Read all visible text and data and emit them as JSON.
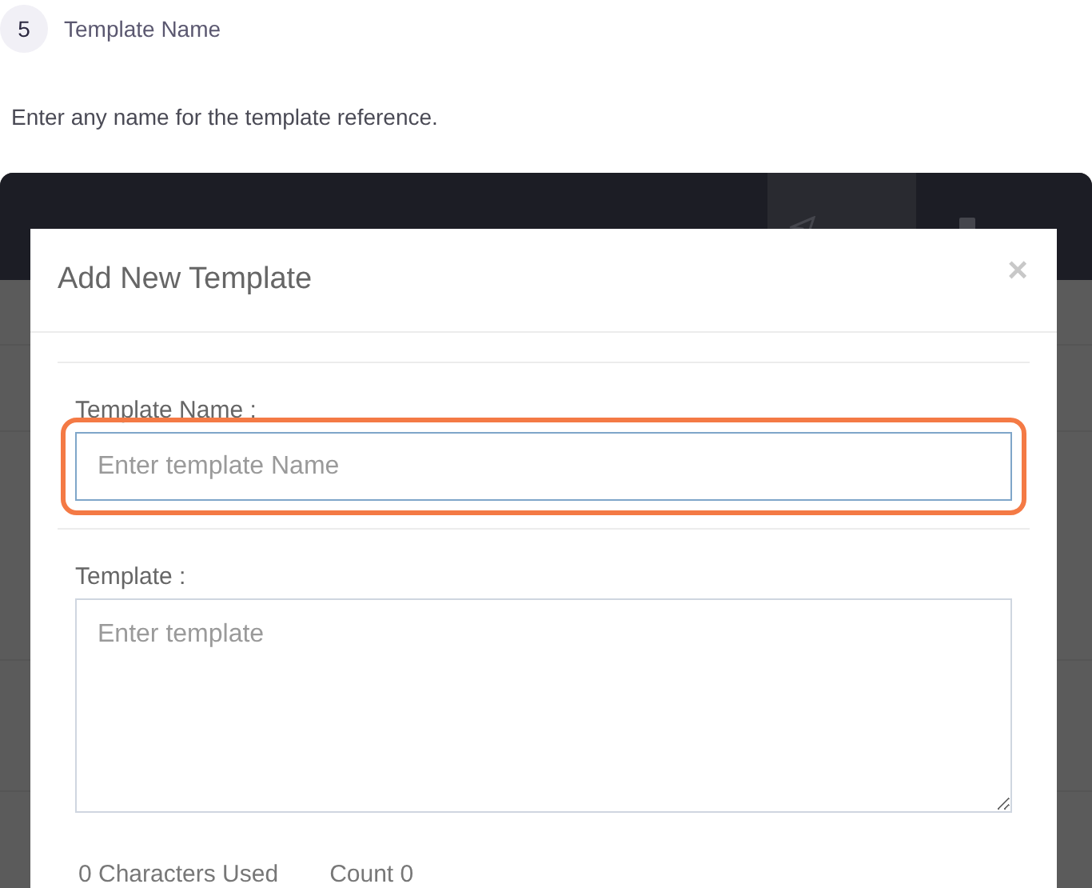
{
  "step": {
    "number": "5",
    "title": "Template Name"
  },
  "description": "Enter any name for the template reference.",
  "background": {
    "nav_tabs": [
      {
        "selected": true
      },
      {
        "selected": false
      }
    ]
  },
  "modal": {
    "title": "Add New Template",
    "close": "×",
    "fields": [
      {
        "kind": "input",
        "label": "Template Name :",
        "placeholder": "Enter template Name",
        "highlighted": true
      },
      {
        "kind": "textarea",
        "label": "Template :",
        "placeholder": "Enter template",
        "highlighted": false
      }
    ],
    "characters_used": "0 Characters Used",
    "count": "Count 0"
  }
}
